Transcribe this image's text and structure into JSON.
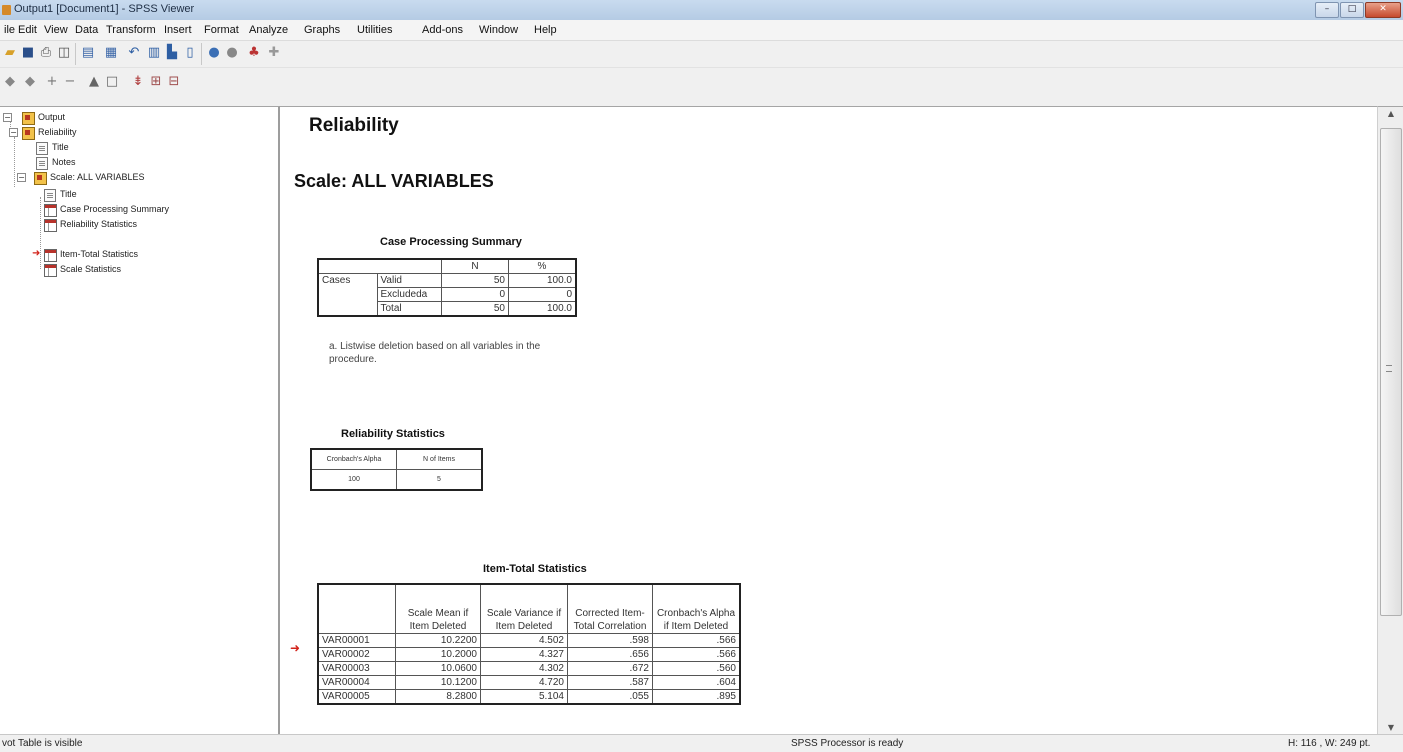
{
  "window": {
    "title": "Output1 [Document1] - SPSS Viewer",
    "min_symbol": "–",
    "max_symbol": "□",
    "close_symbol": "✕"
  },
  "menu": [
    "ile",
    "Edit",
    "View",
    "Data",
    "Transform",
    "Insert",
    "Format",
    "Analyze",
    "Graphs",
    "Utilities",
    "Add-ons",
    "Window",
    "Help"
  ],
  "toolbar_icons": {
    "row1": [
      "open-icon",
      "save-icon",
      "print-icon",
      "print-preview-icon",
      "export-icon",
      "dialog-recall-icon",
      "undo-icon",
      "goto-data-icon",
      "goto-variable-icon",
      "variables-icon",
      "show-all-icon",
      "designate-window-icon",
      "insert-output-icon",
      "run-script-icon"
    ],
    "row2": [
      "promote-icon",
      "demote-icon",
      "expand-icon",
      "collapse-icon",
      "show-icon",
      "hide-icon",
      "insert-heading-icon",
      "insert-title-icon",
      "insert-text-icon"
    ]
  },
  "outline": {
    "items": [
      {
        "label": "Output",
        "icon": "book"
      },
      {
        "label": "Reliability",
        "icon": "book"
      },
      {
        "label": "Title",
        "icon": "doc"
      },
      {
        "label": "Notes",
        "icon": "doc"
      },
      {
        "label": "Scale: ALL VARIABLES",
        "icon": "book"
      },
      {
        "label": "Title",
        "icon": "doc"
      },
      {
        "label": "Case Processing Summary",
        "icon": "table"
      },
      {
        "label": "Reliability Statistics",
        "icon": "table"
      },
      {
        "label": "Item-Total Statistics",
        "icon": "table"
      },
      {
        "label": "Scale Statistics",
        "icon": "table"
      }
    ]
  },
  "content": {
    "heading": "Reliability",
    "subheading": "Scale: ALL VARIABLES",
    "case_processing": {
      "title": "Case Processing Summary",
      "col_n": "N",
      "col_pct": "%",
      "group": "Cases",
      "rows": [
        {
          "label": "Valid",
          "n": "50",
          "pct": "100.0"
        },
        {
          "label": "Excluded",
          "sup": "a",
          "n": "0",
          "pct": "0"
        },
        {
          "label": "Total",
          "n": "50",
          "pct": "100.0"
        }
      ],
      "footnote": "a. Listwise deletion based on all variables in the procedure."
    },
    "reliability_stats": {
      "title": "Reliability Statistics",
      "headers": [
        "Cronbach's Alpha",
        "N of Items"
      ],
      "values": [
        "100",
        "5"
      ]
    },
    "item_total": {
      "title": "Item-Total Statistics",
      "headers": [
        "",
        "Scale Mean if Item Deleted",
        "Scale Variance if Item Deleted",
        "Corrected Item-Total Correlation",
        "Cronbach's Alpha if Item Deleted"
      ],
      "rows": [
        [
          "VAR00001",
          "10.2200",
          "4.502",
          ".598",
          ".566"
        ],
        [
          "VAR00002",
          "10.2000",
          "4.327",
          ".656",
          ".566"
        ],
        [
          "VAR00003",
          "10.0600",
          "4.302",
          ".672",
          ".560"
        ],
        [
          "VAR00004",
          "10.1200",
          "4.720",
          ".587",
          ".604"
        ],
        [
          "VAR00005",
          "8.2800",
          "5.104",
          ".055",
          ".895"
        ]
      ]
    }
  },
  "status": {
    "left": "vot Table is visible",
    "center": "SPSS Processor is ready",
    "right": "H: 116 , W: 249  pt."
  }
}
